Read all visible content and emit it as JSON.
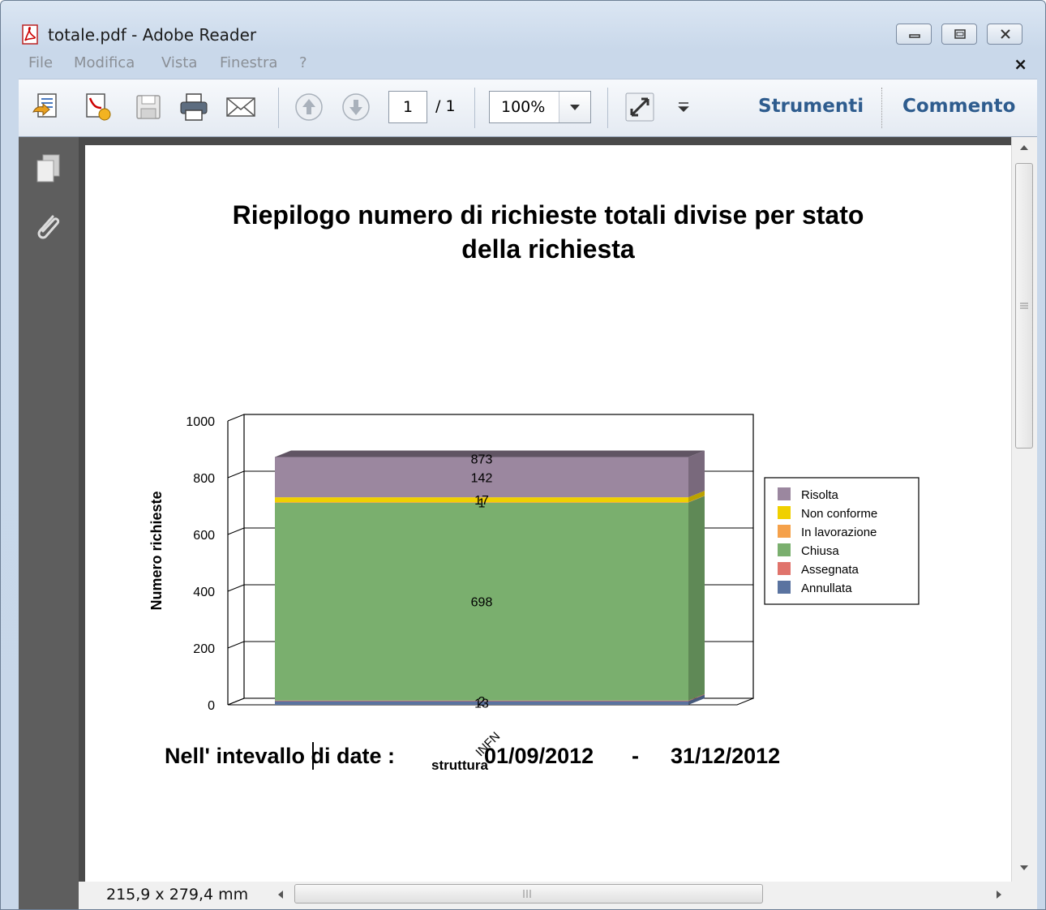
{
  "window": {
    "title": "totale.pdf - Adobe Reader"
  },
  "menu": [
    "File",
    "Modifica",
    "Vista",
    "Finestra",
    "?"
  ],
  "menu_close": "×",
  "toolbar": {
    "page_current": "1",
    "page_total": "/ 1",
    "zoom": "100%",
    "tools_label": "Strumenti",
    "comment_label": "Commento"
  },
  "status": {
    "page_size": "215,9 x 279,4 mm"
  },
  "document": {
    "date_label": "Nell' intevallo di date :",
    "date_from": "01/09/2012",
    "date_sep": "-",
    "date_to": "31/12/2012"
  },
  "chart_data": {
    "type": "bar",
    "stacked": true,
    "title": "Riepilogo numero di richieste totali divise per stato della richiesta",
    "title_lines": [
      "Riepilogo numero di richieste totali divise per stato",
      "della richiesta"
    ],
    "xlabel": "struttura",
    "ylabel": "Numero richieste",
    "categories": [
      "INFN"
    ],
    "ylim": [
      0,
      1000
    ],
    "yticks": [
      0,
      200,
      400,
      600,
      800,
      1000
    ],
    "total_label": "873",
    "series": [
      {
        "name": "Annullata",
        "color": "#5a73a0",
        "values": [
          13
        ],
        "label": "13"
      },
      {
        "name": "Assegnata",
        "color": "#e0736b",
        "values": [
          2
        ],
        "label": "2"
      },
      {
        "name": "Chiusa",
        "color": "#7aaf6e",
        "values": [
          698
        ],
        "label": "698"
      },
      {
        "name": "In lavorazione",
        "color": "#f5a14a",
        "values": [
          1
        ],
        "label": "1"
      },
      {
        "name": "Non conforme",
        "color": "#f0d000",
        "values": [
          17
        ],
        "label": "17"
      },
      {
        "name": "Risolta",
        "color": "#9b879f",
        "values": [
          142
        ],
        "label": "142"
      }
    ],
    "legend_order": [
      "Risolta",
      "Non conforme",
      "In lavorazione",
      "Chiusa",
      "Assegnata",
      "Annullata"
    ],
    "legend": "right",
    "grid": true
  }
}
